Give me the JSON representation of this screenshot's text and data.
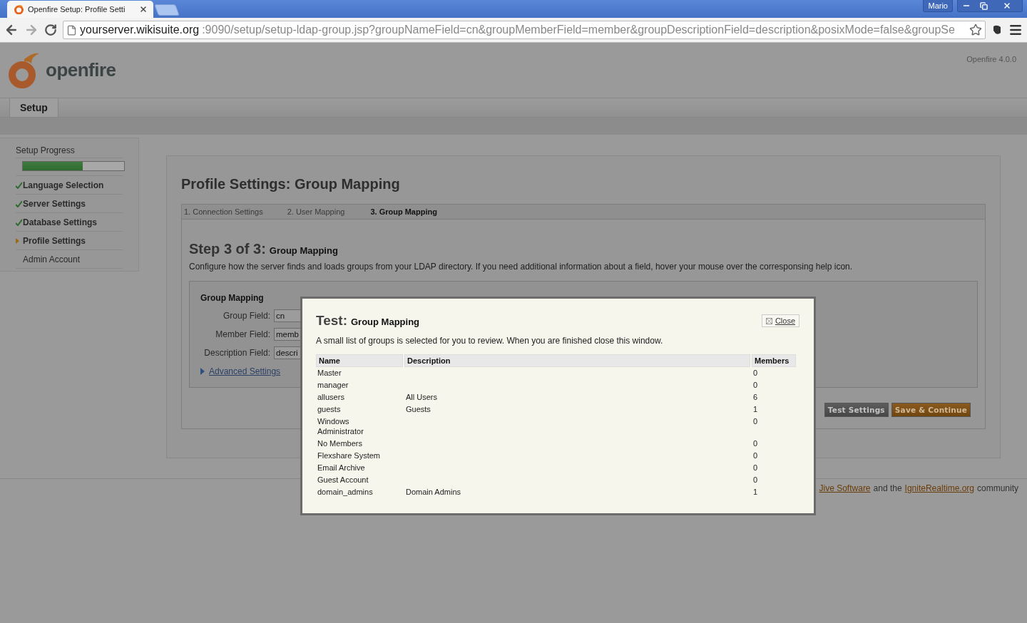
{
  "browser": {
    "tab_title": "Openfire Setup: Profile Setti",
    "user": "Mario",
    "url_host": "yourserver.wikisuite.org",
    "url_rest": ":9090/setup/setup-ldap-group.jsp?groupNameField=cn&groupMemberField=member&groupDescriptionField=description&posixMode=false&groupSe"
  },
  "header": {
    "logo_text": "openfire",
    "version": "Openfire 4.0.0"
  },
  "nav": [
    {
      "label": "Setup",
      "selected": true
    }
  ],
  "sidebar": {
    "title": "Setup Progress",
    "progress": {
      "level": 0.59
    },
    "items": [
      {
        "label": "Language Selection",
        "kind": "done"
      },
      {
        "label": "Server Settings",
        "kind": "done"
      },
      {
        "label": "Database Settings",
        "kind": "done"
      },
      {
        "label": "Profile Settings",
        "kind": "current"
      },
      {
        "label": "Admin Account",
        "kind": "pending"
      }
    ]
  },
  "main": {
    "title": "Profile Settings: Group Mapping",
    "steps": [
      {
        "label": "1. Connection Settings",
        "selected": false
      },
      {
        "label": "2. User Mapping",
        "selected": false
      },
      {
        "label": "3. Group Mapping",
        "selected": true
      }
    ],
    "step_heading": "Step 3 of 3:",
    "step_subheading": "Group Mapping",
    "description": "Configure how the server finds and loads groups from your LDAP directory. If you need additional information about a field, hover your mouse over the corresponsing help icon.",
    "fieldset": {
      "legend": "Group Mapping",
      "fields": [
        {
          "label": "Group Field:",
          "value": "cn"
        },
        {
          "label": "Member Field:",
          "value": "memb"
        },
        {
          "label": "Description Field:",
          "value": "descri"
        }
      ],
      "advanced_link": "Advanced Settings"
    },
    "buttons": [
      {
        "label": "Test Settings",
        "kind": "secondary"
      },
      {
        "label": "Save & Continue",
        "kind": "primary"
      }
    ]
  },
  "footer": [
    {
      "text": "Jive Software",
      "kind": "link"
    },
    {
      "text": "and the",
      "kind": "text"
    },
    {
      "text": "IgniteRealtime.org",
      "kind": "link"
    },
    {
      "text": "community",
      "kind": "text"
    }
  ],
  "modal": {
    "title": "Test:",
    "subtitle": "Group Mapping",
    "close": "Close",
    "description": "A small list of groups is selected for you to review. When you are finished close this window.",
    "columns": [
      "Name",
      "Description",
      "Members"
    ],
    "rows": [
      [
        "Master",
        "",
        "0"
      ],
      [
        "manager",
        "",
        "0"
      ],
      [
        "allusers",
        "All Users",
        "6"
      ],
      [
        "guests",
        "Guests",
        "1"
      ],
      [
        "Windows Administrator",
        "",
        "0"
      ],
      [
        "No Members",
        "",
        "0"
      ],
      [
        "Flexshare System",
        "",
        "0"
      ],
      [
        "Email Archive",
        "",
        "0"
      ],
      [
        "Guest Account",
        "",
        "0"
      ],
      [
        "domain_admins",
        "Domain Admins",
        "1"
      ]
    ]
  }
}
